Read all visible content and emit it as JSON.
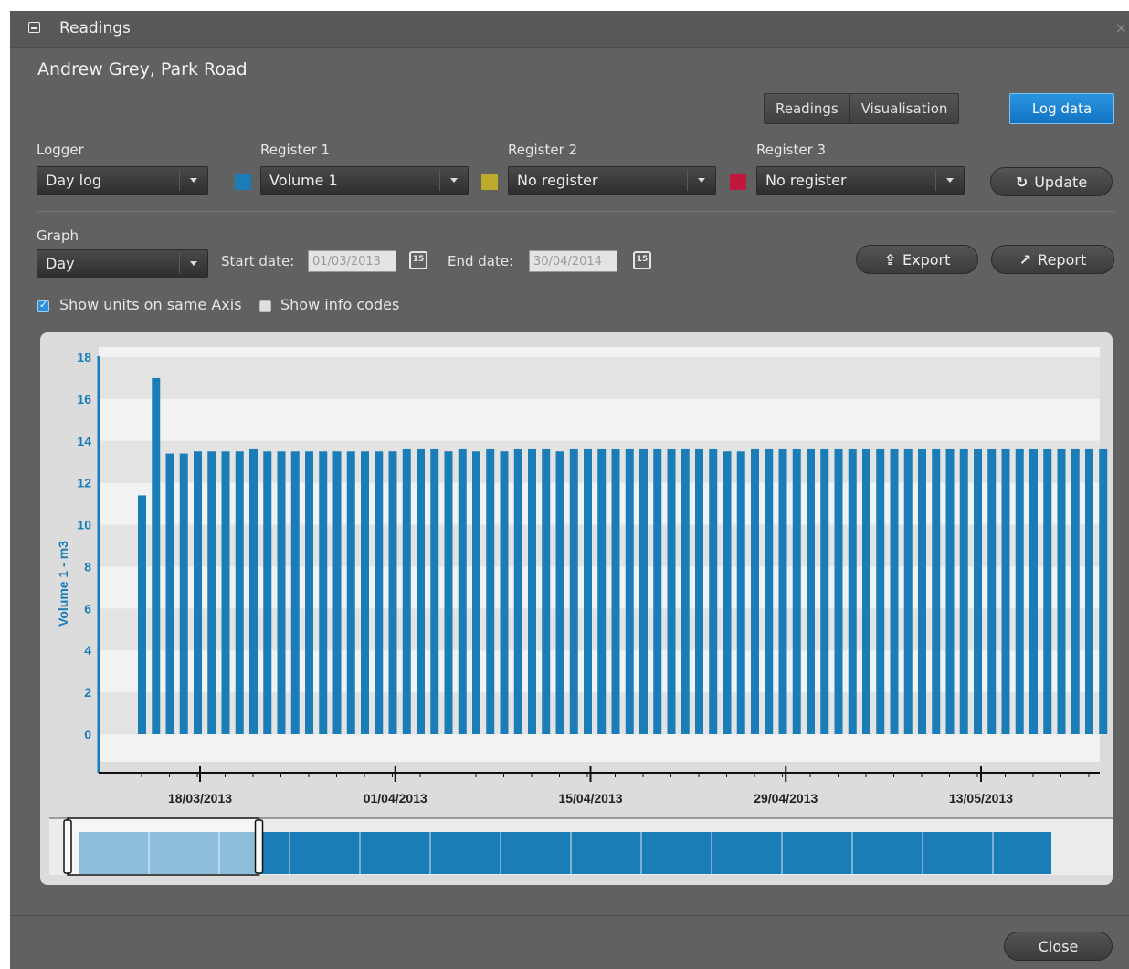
{
  "window": {
    "title": "Readings",
    "icon": "readings-window-icon",
    "close_glyph": "×"
  },
  "customer": "Andrew Grey, Park Road",
  "view_tabs": [
    "Readings",
    "Visualisation"
  ],
  "log_button": "Log data",
  "logger": {
    "label": "Logger",
    "value": "Day log"
  },
  "registers": [
    {
      "label": "Register 1",
      "value": "Volume 1",
      "color": "#1a7db8"
    },
    {
      "label": "Register 2",
      "value": "No register",
      "color": "#bda92b"
    },
    {
      "label": "Register 3",
      "value": "No register",
      "color": "#c0183c"
    }
  ],
  "update_button": "Update",
  "graph": {
    "label": "Graph",
    "value": "Day",
    "start_label": "Start date:",
    "start_value": "01/03/2013",
    "end_label": "End date:",
    "end_value": "30/04/2014",
    "calendar_day": "15"
  },
  "export_button": "Export",
  "report_button": "Report",
  "options": {
    "same_axis": {
      "label": "Show units on same Axis",
      "checked": true
    },
    "info_codes": {
      "label": "Show info codes",
      "checked": false
    }
  },
  "chart_data": {
    "type": "bar",
    "ylabel": "Volume 1 - m3",
    "ylim": [
      0,
      18
    ],
    "yticks": [
      0,
      2,
      4,
      6,
      8,
      10,
      12,
      14,
      16,
      18
    ],
    "x_start": "2013-03-11",
    "x_ticks": [
      "18/03/2013",
      "01/04/2013",
      "15/04/2013",
      "29/04/2013",
      "13/05/2013"
    ],
    "bar_color": "#1a7db8",
    "grid": "horizontal bands",
    "values": [
      11.4,
      17.0,
      13.4,
      13.4,
      13.5,
      13.5,
      13.5,
      13.5,
      13.6,
      13.5,
      13.5,
      13.5,
      13.5,
      13.5,
      13.5,
      13.5,
      13.5,
      13.5,
      13.5,
      13.6,
      13.6,
      13.6,
      13.5,
      13.6,
      13.5,
      13.6,
      13.5,
      13.6,
      13.6,
      13.6,
      13.5,
      13.6,
      13.6,
      13.6,
      13.6,
      13.6,
      13.6,
      13.6,
      13.6,
      13.6,
      13.6,
      13.6,
      13.5,
      13.5,
      13.6,
      13.6,
      13.6,
      13.6,
      13.6,
      13.6,
      13.6,
      13.6,
      13.6,
      13.6,
      13.6,
      13.6,
      13.6,
      13.6,
      13.6,
      13.6,
      13.6,
      13.6,
      13.6,
      13.6,
      13.6,
      13.6,
      13.6,
      13.6,
      13.6,
      13.6,
      13.6,
      13.5
    ]
  },
  "navigator": {
    "selected_fraction": 0.18
  },
  "close_button": "Close"
}
